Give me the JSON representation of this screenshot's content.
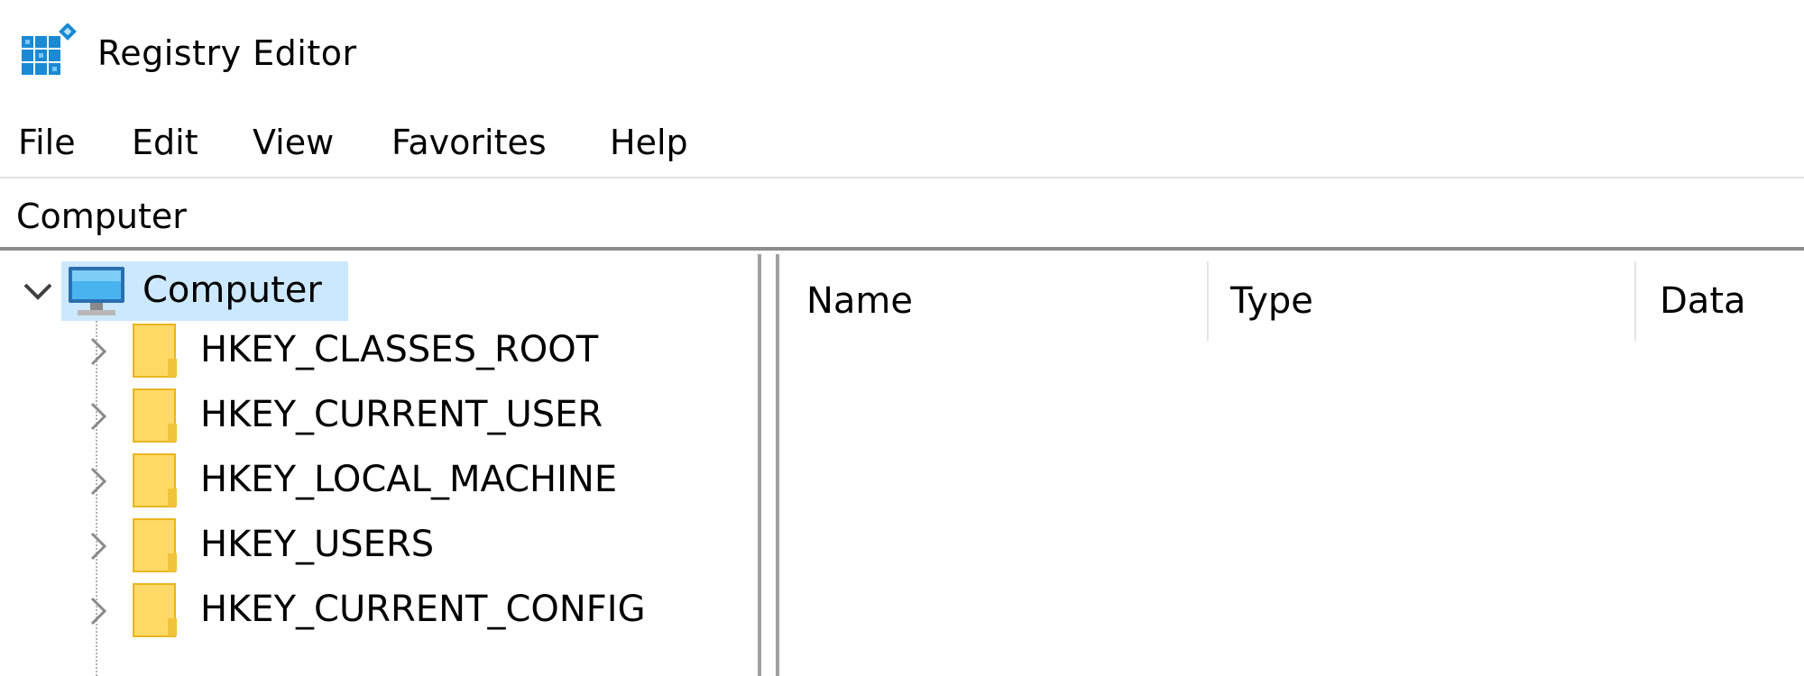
{
  "window": {
    "title": "Registry Editor",
    "app_icon": "registry-editor-icon"
  },
  "menu": {
    "items": [
      "File",
      "Edit",
      "View",
      "Favorites",
      "Help"
    ]
  },
  "address_bar": {
    "value": "Computer"
  },
  "tree": {
    "root": {
      "label": "Computer",
      "icon": "computer-icon",
      "expanded": true,
      "selected": true
    },
    "children": [
      {
        "label": "HKEY_CLASSES_ROOT",
        "icon": "folder-icon",
        "expanded": false
      },
      {
        "label": "HKEY_CURRENT_USER",
        "icon": "folder-icon",
        "expanded": false
      },
      {
        "label": "HKEY_LOCAL_MACHINE",
        "icon": "folder-icon",
        "expanded": false
      },
      {
        "label": "HKEY_USERS",
        "icon": "folder-icon",
        "expanded": false
      },
      {
        "label": "HKEY_CURRENT_CONFIG",
        "icon": "folder-icon",
        "expanded": false
      }
    ]
  },
  "values_list": {
    "columns": [
      "Name",
      "Type",
      "Data"
    ],
    "rows": []
  },
  "colors": {
    "selection": "#cce8ff",
    "folder_fill": "#ffd966",
    "folder_stroke": "#e8b520",
    "icon_blue": "#1a8ad4"
  }
}
